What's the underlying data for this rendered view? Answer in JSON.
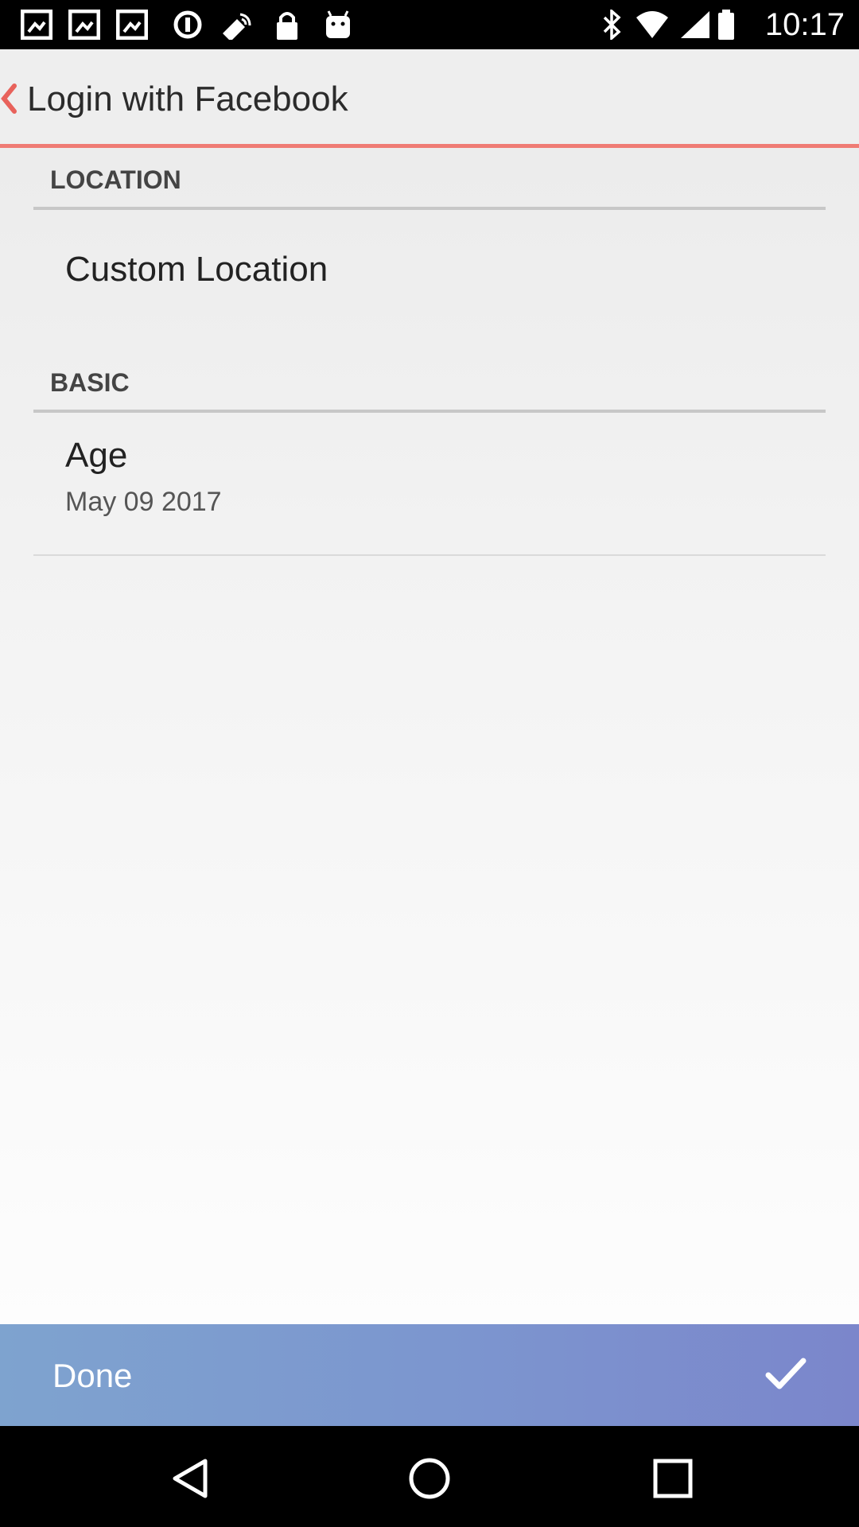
{
  "status_bar": {
    "time": "10:17",
    "icons": [
      "gallery-icon",
      "gallery-icon",
      "gallery-icon",
      "data-saver-icon",
      "fake-gps-icon",
      "lock-icon",
      "android-icon",
      "bluetooth-icon",
      "wifi-icon",
      "signal-icon",
      "battery-icon"
    ]
  },
  "app_bar": {
    "title": "Login with Facebook",
    "accent_color": "#ef7b74"
  },
  "sections": [
    {
      "header": "LOCATION",
      "items": [
        {
          "title": "Custom Location"
        }
      ]
    },
    {
      "header": "BASIC",
      "items": [
        {
          "title": "Age",
          "summary": "May 09 2017"
        }
      ]
    }
  ],
  "bottom_bar": {
    "label": "Done",
    "icon": "check-icon",
    "color": "#7c95cf"
  },
  "nav_bar": {
    "icons": [
      "back-triangle-icon",
      "home-circle-icon",
      "recents-square-icon"
    ]
  }
}
